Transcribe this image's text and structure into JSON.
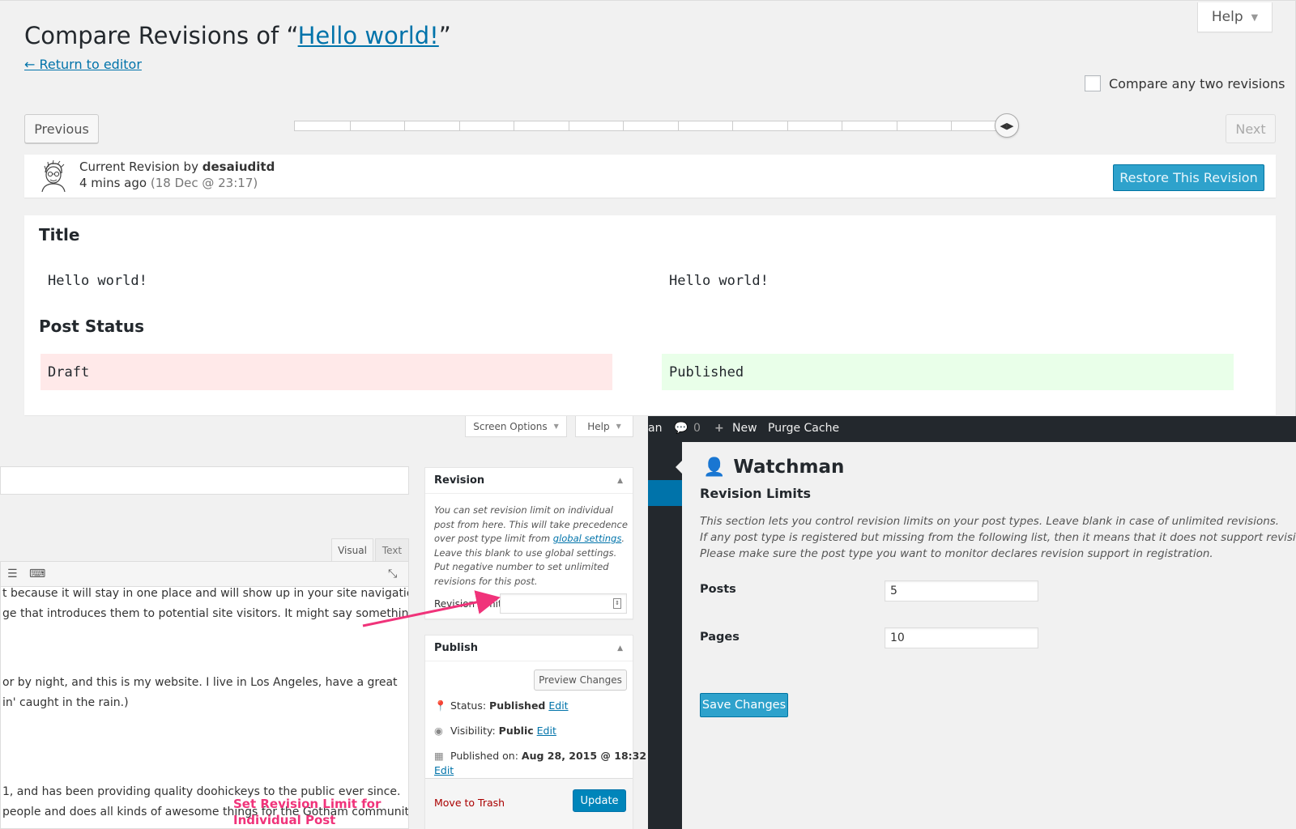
{
  "compare": {
    "help_label": "Help",
    "title_prefix": "Compare Revisions of “",
    "title_link": "Hello world!",
    "title_suffix": "”",
    "return_link": "← Return to editor",
    "compare_any_label": "Compare any two revisions",
    "previous_label": "Previous",
    "next_label": "Next",
    "revision": {
      "prefix": "Current Revision by ",
      "author": "desaiuditd",
      "time_ago": "4 mins ago",
      "date": "(18 Dec @ 23:17)"
    },
    "restore_label": "Restore This Revision",
    "diff": {
      "title_heading": "Title",
      "title_old": "Hello world!",
      "title_new": "Hello world!",
      "status_heading": "Post Status",
      "status_old": "Draft",
      "status_new": "Published"
    }
  },
  "editor": {
    "screen_options_label": "Screen Options",
    "help_label": "Help",
    "tab_visual": "Visual",
    "tab_text": "Text",
    "content_lines": [
      "t because it will stay in one place and will show up in your site navigation",
      "ge that introduces them to potential site visitors. It might say something like",
      "or by night, and this is my website. I live in Los Angeles, have a great",
      "in' caught in the rain.)",
      "1, and has been providing quality doohickeys to the public ever since.",
      "people and does all kinds of awesome things for the Gotham community."
    ],
    "annotation_line1": "Set Revision Limit for",
    "annotation_line2": "Individual Post",
    "revision_box": {
      "heading": "Revision",
      "desc_part1": "You can set revision limit on individual post from here. This will take precedence over post type limit from ",
      "desc_link": "global settings",
      "desc_part2": ". Leave this blank to use global settings. Put negative number to set unlimited revisions for this post.",
      "limit_label": "Revision Limit"
    },
    "publish_box": {
      "heading": "Publish",
      "preview_label": "Preview Changes",
      "status_label": "Status: ",
      "status_value": "Published",
      "visibility_label": "Visibility: ",
      "visibility_value": "Public",
      "published_label": "Published on: ",
      "published_value": "Aug 28, 2015 @ 18:32",
      "edit_label": "Edit",
      "trash_label": "Move to Trash",
      "update_label": "Update"
    }
  },
  "watchman": {
    "adminbar": {
      "site_fragment": "an",
      "comments_count": "0",
      "new_label": "New",
      "purge_label": "Purge Cache"
    },
    "title": "Watchman",
    "section_title": "Revision Limits",
    "desc_lines": [
      "This section lets you control revision limits on your post types. Leave blank in case of unlimited revisions.",
      "If any post type is registered but missing from the following list, then it means that it does not support revisions.",
      "Please make sure the post type you want to monitor declares revision support in registration."
    ],
    "posts_label": "Posts",
    "posts_value": "5",
    "pages_label": "Pages",
    "pages_value": "10",
    "save_label": "Save Changes"
  },
  "colors": {
    "link": "#0073aa",
    "primary_button": "#2ea2cc",
    "diff_removed": "#ffe9e9",
    "diff_added": "#e9ffe9",
    "annotation": "#f0337a",
    "admin_bar": "#23282d"
  }
}
